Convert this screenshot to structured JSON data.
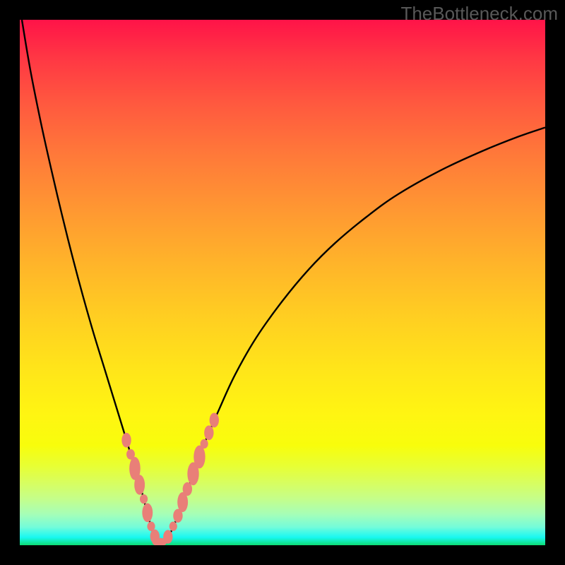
{
  "watermark": "TheBottleneck.com",
  "chart_data": {
    "type": "line",
    "title": "",
    "xlabel": "",
    "ylabel": "",
    "x_range": [
      0,
      100
    ],
    "y_range": [
      0,
      100
    ],
    "series": [
      {
        "name": "left-curve",
        "x": [
          0.4,
          2,
          4,
          6,
          8,
          10,
          12,
          14,
          16,
          18,
          20,
          21.5,
          23,
          24.3,
          25.3,
          26
        ],
        "y": [
          100,
          90.5,
          80.5,
          71.5,
          63,
          55,
          47.5,
          40.5,
          34,
          27.5,
          21,
          16,
          11,
          6,
          2.5,
          0.5
        ]
      },
      {
        "name": "right-curve",
        "x": [
          27.5,
          29,
          31,
          33,
          35,
          38,
          41,
          45,
          50,
          55,
          60,
          66,
          72,
          80,
          88,
          95,
          100
        ],
        "y": [
          0.5,
          3,
          8,
          13.5,
          19,
          26,
          32.5,
          39.5,
          46.5,
          52.5,
          57.5,
          62.5,
          66.8,
          71.3,
          75,
          77.8,
          79.5
        ]
      }
    ],
    "markers": {
      "name": "beads",
      "color": "#e97f78",
      "items": [
        {
          "cx": 20.3,
          "cy": 20.0,
          "rx": 0.9,
          "ry": 1.4
        },
        {
          "cx": 21.1,
          "cy": 17.3,
          "rx": 0.8,
          "ry": 1.0
        },
        {
          "cx": 21.9,
          "cy": 14.6,
          "rx": 1.05,
          "ry": 2.2
        },
        {
          "cx": 22.8,
          "cy": 11.5,
          "rx": 1.0,
          "ry": 1.9
        },
        {
          "cx": 23.6,
          "cy": 8.8,
          "rx": 0.75,
          "ry": 0.9
        },
        {
          "cx": 24.3,
          "cy": 6.2,
          "rx": 1.0,
          "ry": 1.8
        },
        {
          "cx": 25.0,
          "cy": 3.6,
          "rx": 0.75,
          "ry": 0.9
        },
        {
          "cx": 25.7,
          "cy": 1.7,
          "rx": 0.9,
          "ry": 1.3
        },
        {
          "cx": 26.6,
          "cy": 0.6,
          "rx": 1.4,
          "ry": 0.8
        },
        {
          "cx": 28.2,
          "cy": 1.6,
          "rx": 0.9,
          "ry": 1.3
        },
        {
          "cx": 29.2,
          "cy": 3.6,
          "rx": 0.75,
          "ry": 0.9
        },
        {
          "cx": 30.1,
          "cy": 5.6,
          "rx": 0.9,
          "ry": 1.3
        },
        {
          "cx": 31.0,
          "cy": 8.2,
          "rx": 1.0,
          "ry": 1.9
        },
        {
          "cx": 31.9,
          "cy": 10.7,
          "rx": 0.9,
          "ry": 1.3
        },
        {
          "cx": 33.0,
          "cy": 13.6,
          "rx": 1.1,
          "ry": 2.2
        },
        {
          "cx": 34.2,
          "cy": 16.8,
          "rx": 1.1,
          "ry": 2.2
        },
        {
          "cx": 35.1,
          "cy": 19.3,
          "rx": 0.75,
          "ry": 0.9
        },
        {
          "cx": 36.0,
          "cy": 21.4,
          "rx": 0.9,
          "ry": 1.4
        },
        {
          "cx": 37.0,
          "cy": 23.8,
          "rx": 0.9,
          "ry": 1.4
        }
      ]
    }
  }
}
